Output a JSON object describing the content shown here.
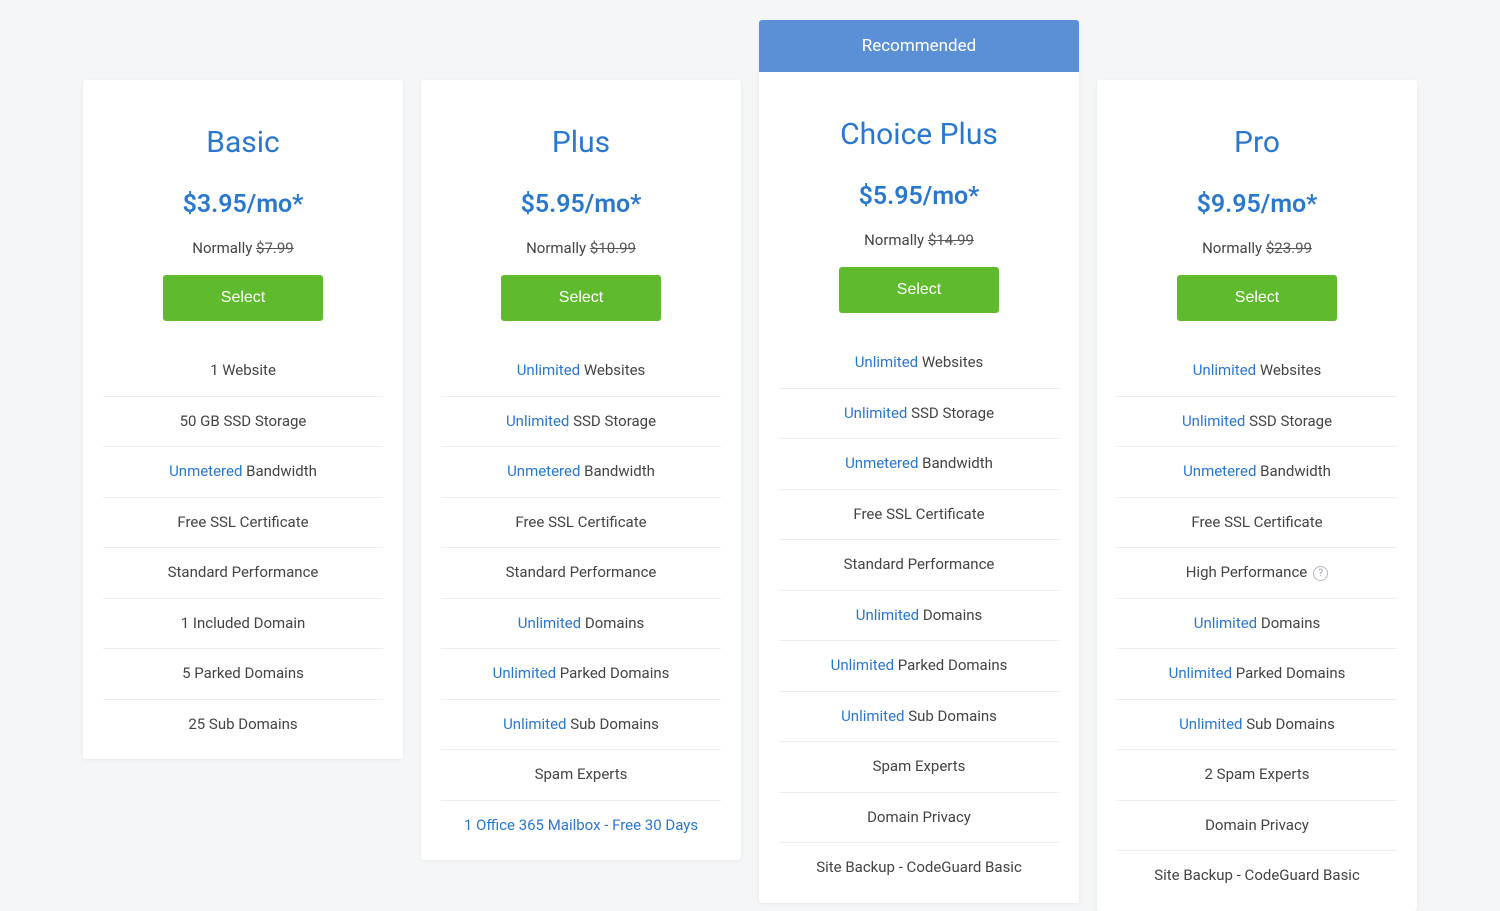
{
  "recommended_label": "Recommended",
  "plans": [
    {
      "name": "Basic",
      "price": "$3.95/mo*",
      "normally_prefix": "Normally ",
      "normally_price": "$7.99",
      "select_label": "Select",
      "recommended": false,
      "features": [
        {
          "text": "1 Website"
        },
        {
          "text": "50 GB SSD Storage"
        },
        {
          "highlight": "Unmetered",
          "text": " Bandwidth"
        },
        {
          "text": "Free SSL Certificate"
        },
        {
          "text": "Standard Performance"
        },
        {
          "text": "1 Included Domain"
        },
        {
          "text": "5 Parked Domains"
        },
        {
          "text": "25 Sub Domains"
        }
      ]
    },
    {
      "name": "Plus",
      "price": "$5.95/mo*",
      "normally_prefix": "Normally ",
      "normally_price": "$10.99",
      "select_label": "Select",
      "recommended": false,
      "features": [
        {
          "highlight": "Unlimited",
          "text": " Websites"
        },
        {
          "highlight": "Unlimited",
          "text": " SSD Storage"
        },
        {
          "highlight": "Unmetered",
          "text": " Bandwidth"
        },
        {
          "text": "Free SSL Certificate"
        },
        {
          "text": "Standard Performance"
        },
        {
          "highlight": "Unlimited",
          "text": " Domains"
        },
        {
          "highlight": "Unlimited",
          "text": " Parked Domains"
        },
        {
          "highlight": "Unlimited",
          "text": " Sub Domains"
        },
        {
          "text": "Spam Experts"
        },
        {
          "highlight": "1 Office 365 Mailbox - Free 30 Days"
        }
      ]
    },
    {
      "name": "Choice Plus",
      "price": "$5.95/mo*",
      "normally_prefix": "Normally ",
      "normally_price": "$14.99",
      "select_label": "Select",
      "recommended": true,
      "features": [
        {
          "highlight": "Unlimited",
          "text": " Websites"
        },
        {
          "highlight": "Unlimited",
          "text": " SSD Storage"
        },
        {
          "highlight": "Unmetered",
          "text": " Bandwidth"
        },
        {
          "text": "Free SSL Certificate"
        },
        {
          "text": "Standard Performance"
        },
        {
          "highlight": "Unlimited",
          "text": " Domains"
        },
        {
          "highlight": "Unlimited",
          "text": " Parked Domains"
        },
        {
          "highlight": "Unlimited",
          "text": " Sub Domains"
        },
        {
          "text": "Spam Experts"
        },
        {
          "text": "Domain Privacy"
        },
        {
          "text": "Site Backup - CodeGuard Basic"
        }
      ]
    },
    {
      "name": "Pro",
      "price": "$9.95/mo*",
      "normally_prefix": "Normally ",
      "normally_price": "$23.99",
      "select_label": "Select",
      "recommended": false,
      "features": [
        {
          "highlight": "Unlimited",
          "text": " Websites"
        },
        {
          "highlight": "Unlimited",
          "text": " SSD Storage"
        },
        {
          "highlight": "Unmetered",
          "text": " Bandwidth"
        },
        {
          "text": "Free SSL Certificate"
        },
        {
          "text": "High Performance",
          "info": true
        },
        {
          "highlight": "Unlimited",
          "text": " Domains"
        },
        {
          "highlight": "Unlimited",
          "text": " Parked Domains"
        },
        {
          "highlight": "Unlimited",
          "text": " Sub Domains"
        },
        {
          "text": "2 Spam Experts"
        },
        {
          "text": "Domain Privacy"
        },
        {
          "text": "Site Backup - CodeGuard Basic"
        }
      ]
    }
  ]
}
